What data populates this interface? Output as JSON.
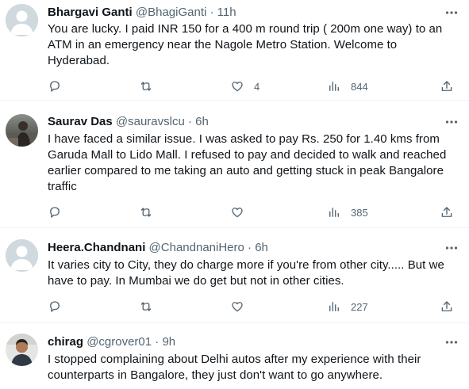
{
  "tweets": [
    {
      "name": "Bhargavi Ganti",
      "handle": "@BhagiGanti",
      "time": "· 11h",
      "text": "You are lucky. I paid INR 150 for a 400 m round trip ( 200m one way) to an ATM in an emergency near the Nagole Metro Station.  Welcome to Hyderabad.",
      "likes": "4",
      "views": "844",
      "avatar": "default-avatar"
    },
    {
      "name": "Saurav Das",
      "handle": "@sauravslcu",
      "time": "· 6h",
      "text": "I have faced a similar issue. I was asked to pay Rs. 250 for 1.40 kms from Garuda Mall to Lido Mall. I refused to pay and decided to walk and reached earlier compared to me taking an auto and getting stuck in peak Bangalore traffic",
      "likes": "",
      "views": "385",
      "avatar": "photo-avatar"
    },
    {
      "name": "Heera.Chandnani",
      "handle": "@ChandnaniHero",
      "time": "· 6h",
      "text": "It varies city to City, they do charge more if you're from other city..... But we have to pay. In Mumbai we do get but not in other cities.",
      "likes": "",
      "views": "227",
      "avatar": "default-avatar"
    },
    {
      "name": "chirag",
      "handle": "@cgrover01",
      "time": "· 9h",
      "text": "I stopped complaining about Delhi autos after my experience with their counterparts in Bangalore, they just don't want to go anywhere.",
      "likes": "",
      "views": "",
      "avatar": "photo-avatar"
    }
  ],
  "icons": {
    "reply": "reply-icon",
    "retweet": "retweet-icon",
    "like": "like-icon",
    "views": "views-icon",
    "share": "share-icon",
    "more": "more-icon"
  },
  "colors": {
    "text": "#0f1419",
    "secondary": "#536471",
    "divider": "#eff3f4",
    "default_avatar": "#cfd9de"
  }
}
